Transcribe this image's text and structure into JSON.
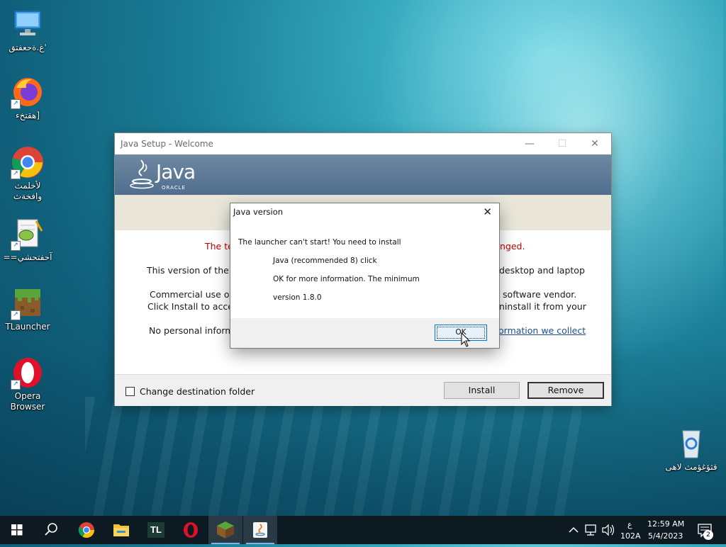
{
  "desktop": {
    "icons": [
      {
        "label": "غ.ةحعفتق'"
      },
      {
        "label": "هقتخء]"
      },
      {
        "label": "لأخلمث وافخةث"
      },
      {
        "label": "==آحفتحشي"
      },
      {
        "label": "TLauncher"
      },
      {
        "label": "Opera Browser"
      },
      {
        "label": "قثؤغؤمث لاهى"
      }
    ]
  },
  "java_setup": {
    "title": "Java Setup - Welcome",
    "brand": "Java",
    "brand_sub": "ORACLE",
    "line_red_left": "The te",
    "line_red_right": "nged.",
    "line1_left": "This version of the Ja",
    "line1_right": "desktop and laptop",
    "line2_left": "Commercial use of t",
    "line2_right": "ur software vendor.",
    "line3_left": "Click Install to accep",
    "line3_right": "ninstall it from your",
    "line4_left": "No personal inform",
    "line4_link": "ormation we collect",
    "checkbox_label": "Change destination folder",
    "install_label": "Install",
    "remove_label": "Remove"
  },
  "dialog": {
    "title": "Java version",
    "line1": "The launcher can't start! You need to install",
    "line2": "Java (recommended 8) click",
    "line3": "OK for more information. The minimum",
    "line4": "version 1.8.0",
    "ok_label": "OK"
  },
  "taskbar": {
    "tl_label": "TL",
    "lang_top": "ع",
    "lang_bottom": "102A",
    "time": "12:59 AM",
    "date": "5/4/2023",
    "notification_count": "2"
  },
  "colors": {
    "java_banner": "#5c7896",
    "error_red": "#c00000",
    "taskbar": "#0d1a22",
    "ok_border": "#0078d7"
  }
}
